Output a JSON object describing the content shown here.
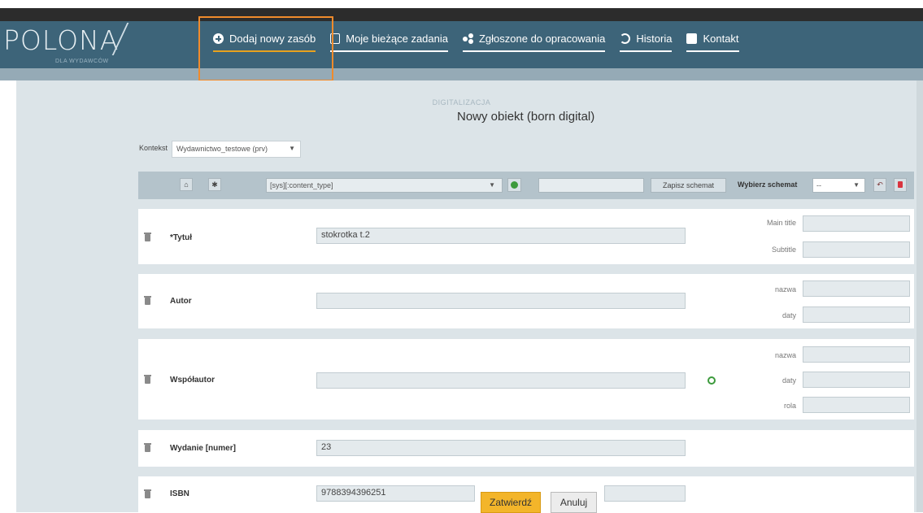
{
  "header": {
    "logo_text": "POLONA",
    "logo_sub": "DLA WYDAWCÓW",
    "nav": [
      {
        "label": "Dodaj nowy zasób",
        "icon": "plus-circle-icon",
        "active": true
      },
      {
        "label": "Moje bieżące zadania",
        "icon": "clipboard-icon"
      },
      {
        "label": "Zgłoszone do opracowania",
        "icon": "share-icon"
      },
      {
        "label": "Historia",
        "icon": "history-icon"
      },
      {
        "label": "Kontakt",
        "icon": "phone-icon"
      }
    ]
  },
  "page": {
    "section": "DIGITALIZACJA",
    "title": "Nowy obiekt (born digital)"
  },
  "kontekst": {
    "label": "Kontekst",
    "value": "Wydawnictwo_testowe (prv)"
  },
  "toolbar": {
    "content_type": "[sys][:content_type]",
    "save_schema": "Zapisz schemat",
    "choose_schema_label": "Wybierz schemat",
    "choose_schema_value": "--"
  },
  "fields": {
    "tytul": {
      "label": "*Tytuł",
      "value": "stokrotka t.2",
      "sub": [
        "Main title",
        "Subtitle"
      ]
    },
    "autor": {
      "label": "Autor",
      "value": "",
      "sub": [
        "nazwa",
        "daty"
      ]
    },
    "wspolautor": {
      "label": "Współautor",
      "value": "",
      "sub": [
        "nazwa",
        "daty",
        "rola"
      ]
    },
    "wydanie": {
      "label": "Wydanie [numer]",
      "value": "23"
    },
    "isbn": {
      "label": "ISBN",
      "value": "9788394396251"
    }
  },
  "actions": {
    "confirm": "Zatwierdź",
    "cancel": "Anuluj"
  },
  "colors": {
    "navbar": "#3d6479",
    "accent": "#e8a21e",
    "highlight_box": "#f08b2c",
    "confirm_button": "#f3b52a"
  }
}
